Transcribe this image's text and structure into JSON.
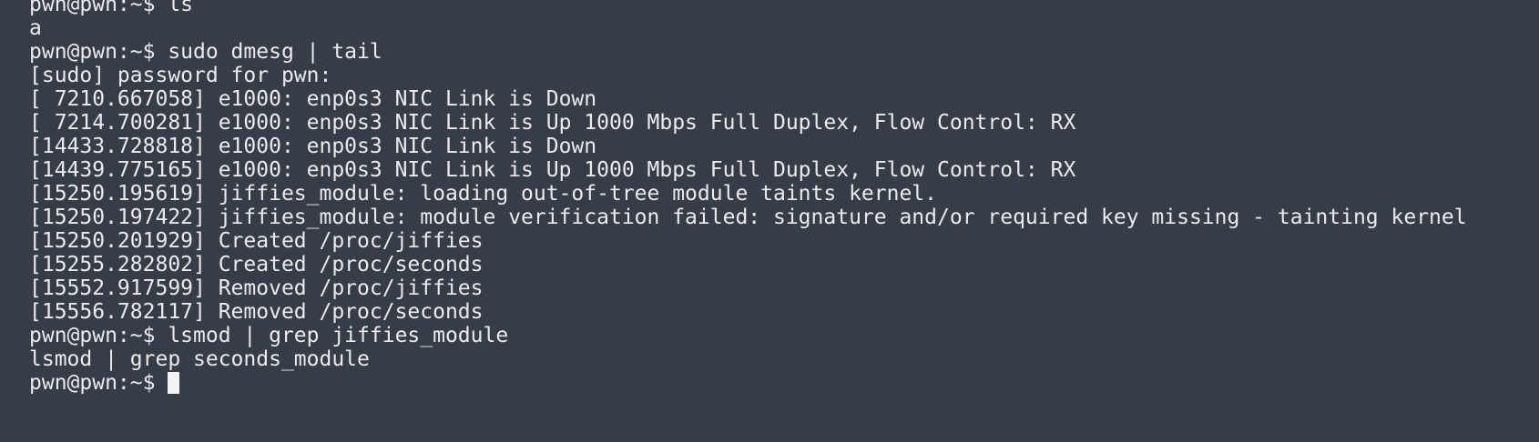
{
  "terminal": {
    "lines": [
      "pwn@pwn:~$ ls",
      "a",
      "pwn@pwn:~$ sudo dmesg | tail",
      "[sudo] password for pwn:",
      "[ 7210.667058] e1000: enp0s3 NIC Link is Down",
      "[ 7214.700281] e1000: enp0s3 NIC Link is Up 1000 Mbps Full Duplex, Flow Control: RX",
      "[14433.728818] e1000: enp0s3 NIC Link is Down",
      "[14439.775165] e1000: enp0s3 NIC Link is Up 1000 Mbps Full Duplex, Flow Control: RX",
      "[15250.195619] jiffies_module: loading out-of-tree module taints kernel.",
      "[15250.197422] jiffies_module: module verification failed: signature and/or required key missing - tainting kernel",
      "[15250.201929] Created /proc/jiffies",
      "[15255.282802] Created /proc/seconds",
      "[15552.917599] Removed /proc/jiffies",
      "[15556.782117] Removed /proc/seconds",
      "pwn@pwn:~$ lsmod | grep jiffies_module",
      "lsmod | grep seconds_module"
    ],
    "prompt": "pwn@pwn:~$"
  },
  "colors": {
    "background": "#373d47",
    "text": "#e9ebee",
    "cursor": "#f2f3f5"
  }
}
